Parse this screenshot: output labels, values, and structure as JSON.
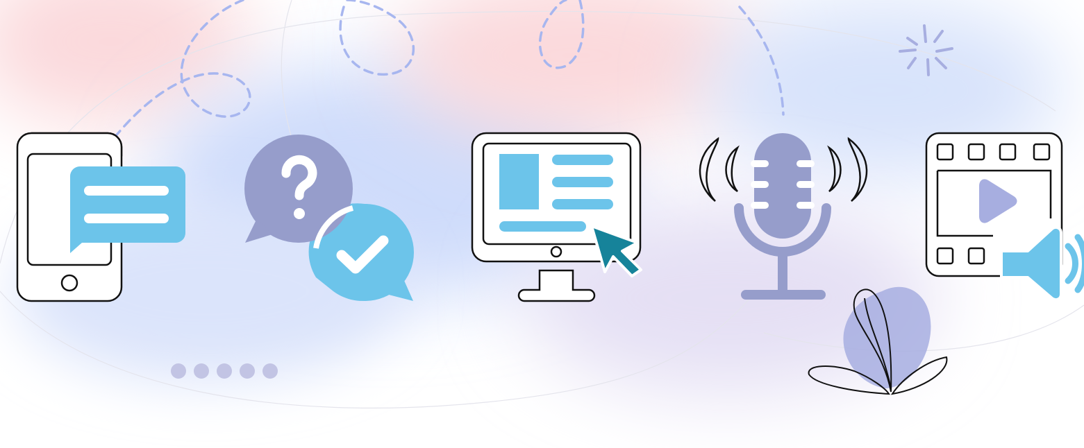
{
  "colors": {
    "background": "#ffffff",
    "outline": "#111111",
    "light_blue": "#6cc4ea",
    "purple": "#969dcb",
    "lavender": "#a7aee0",
    "teal": "#16839a",
    "dots": "#c2c4e4",
    "dashes": "#a7b6ef",
    "blob_blue": "#cfdcfb",
    "blob_pink": "#fbd9dc",
    "blob_violet": "#e5e0f4"
  },
  "icons": [
    "smartphone-message-icon",
    "question-answer-chat-icon",
    "desktop-cursor-icon",
    "podcast-microphone-icon",
    "video-film-audio-icon"
  ],
  "decorations": [
    "dashed-loop-path",
    "sparkle-burst",
    "dot-row",
    "leaf-plant"
  ],
  "dot_count": 5
}
